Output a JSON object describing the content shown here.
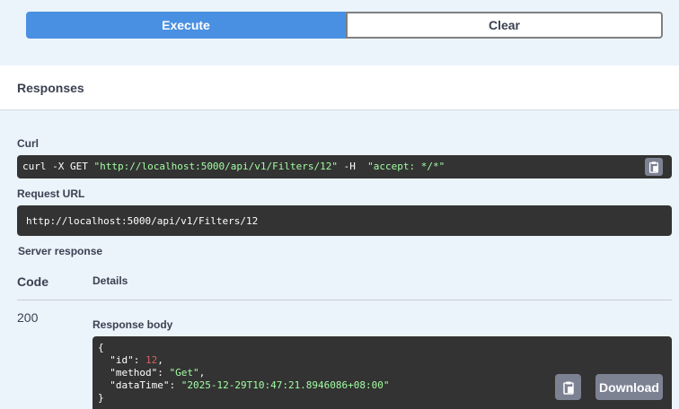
{
  "actions": {
    "execute_label": "Execute",
    "clear_label": "Clear"
  },
  "responses": {
    "title": "Responses",
    "curl_label": "Curl",
    "curl": {
      "cmd": "curl -X GET ",
      "url": "\"http://localhost:5000/api/v1/Filters/12\"",
      "flag": " -H  ",
      "header": "\"accept: */*\""
    },
    "request_url_label": "Request URL",
    "request_url": "http://localhost:5000/api/v1/Filters/12",
    "server_response_label": "Server response",
    "code_header": "Code",
    "details_header": "Details",
    "code": "200",
    "response_body_label": "Response body",
    "body": {
      "open": "{",
      "id_key": "\"id\"",
      "id_val": "12",
      "method_key": "\"method\"",
      "method_val": "\"Get\"",
      "datatime_key": "\"dataTime\"",
      "datatime_val": "\"2025-12-29T10:47:21.8946086+08:00\"",
      "close": "}"
    },
    "download_label": "Download"
  },
  "icons": {
    "copy": "clipboard-icon"
  },
  "colors": {
    "execute": "#4990e2",
    "code_bg": "#333333",
    "string": "#a2fca2",
    "number": "#d36363"
  }
}
